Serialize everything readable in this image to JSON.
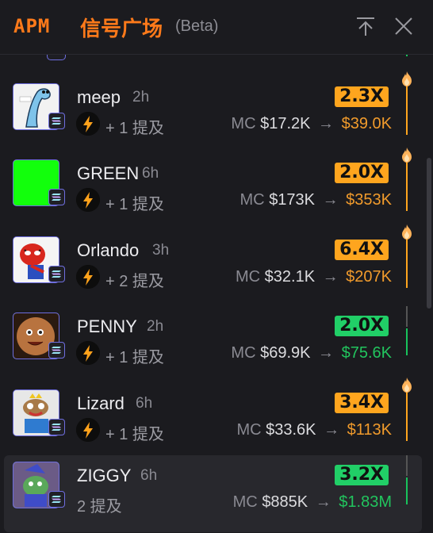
{
  "header": {
    "brand": "APM",
    "title": "信号广场",
    "beta": "(Beta)"
  },
  "colors": {
    "accent": "#ff7a1a",
    "multiplier_orange": "#fea51e",
    "multiplier_green": "#21cf67",
    "gain_orange": "#f19b2c",
    "gain_green": "#22c55e"
  },
  "signals": [
    {
      "name": "meep",
      "age": "2h",
      "mentions": "+ 1 提及",
      "multiplier": "2.3X",
      "mc_label": "MC",
      "mc_from": "$17.2K",
      "arrow": "→",
      "mc_to": "$39.0K",
      "tone": "orange",
      "fire": true,
      "avatar_icon": "meep-avatar"
    },
    {
      "name": "GREEN",
      "age": "6h",
      "mentions": "+ 1 提及",
      "multiplier": "2.0X",
      "mc_label": "MC",
      "mc_from": "$173K",
      "arrow": "→",
      "mc_to": "$353K",
      "tone": "orange",
      "fire": true,
      "avatar_icon": "green-square-avatar"
    },
    {
      "name": "Orlando",
      "age": "3h",
      "mentions": "+ 2 提及",
      "multiplier": "6.4X",
      "mc_label": "MC",
      "mc_from": "$32.1K",
      "arrow": "→",
      "mc_to": "$207K",
      "tone": "orange",
      "fire": true,
      "avatar_icon": "spider-avatar"
    },
    {
      "name": "PENNY",
      "age": "2h",
      "mentions": "+ 1 提及",
      "multiplier": "2.0X",
      "mc_label": "MC",
      "mc_from": "$69.9K",
      "arrow": "→",
      "mc_to": "$75.6K",
      "tone": "green",
      "fire": false,
      "avatar_icon": "penny-avatar"
    },
    {
      "name": "Lizard",
      "age": "6h",
      "mentions": "+ 1 提及",
      "multiplier": "3.4X",
      "mc_label": "MC",
      "mc_from": "$33.6K",
      "arrow": "→",
      "mc_to": "$113K",
      "tone": "orange",
      "fire": true,
      "avatar_icon": "lizard-avatar"
    },
    {
      "name": "ZIGGY",
      "age": "6h",
      "mentions": "2 提及",
      "multiplier": "3.2X",
      "mc_label": "MC",
      "mc_from": "$885K",
      "arrow": "→",
      "mc_to": "$1.83M",
      "tone": "green",
      "fire": false,
      "avatar_icon": "ziggy-avatar"
    }
  ]
}
